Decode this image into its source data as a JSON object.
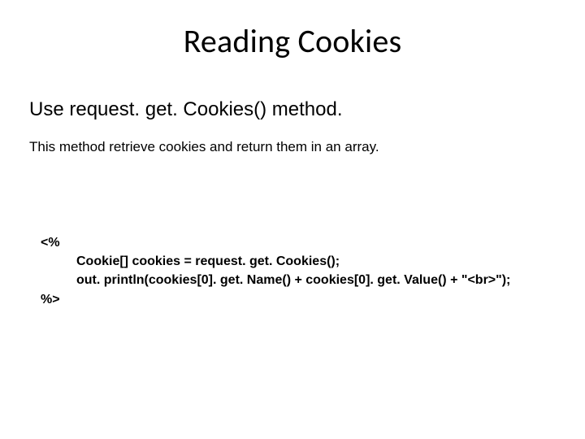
{
  "title": "Reading Cookies",
  "subheading": "Use request. get. Cookies() method.",
  "description": "This method retrieve cookies and return them in an array.",
  "code": {
    "open": "<%",
    "line1": "Cookie[] cookies = request. get. Cookies();",
    "line2": "out. println(cookies[0]. get. Name() + cookies[0]. get. Value() + \"<br>\");",
    "close": "%>"
  }
}
